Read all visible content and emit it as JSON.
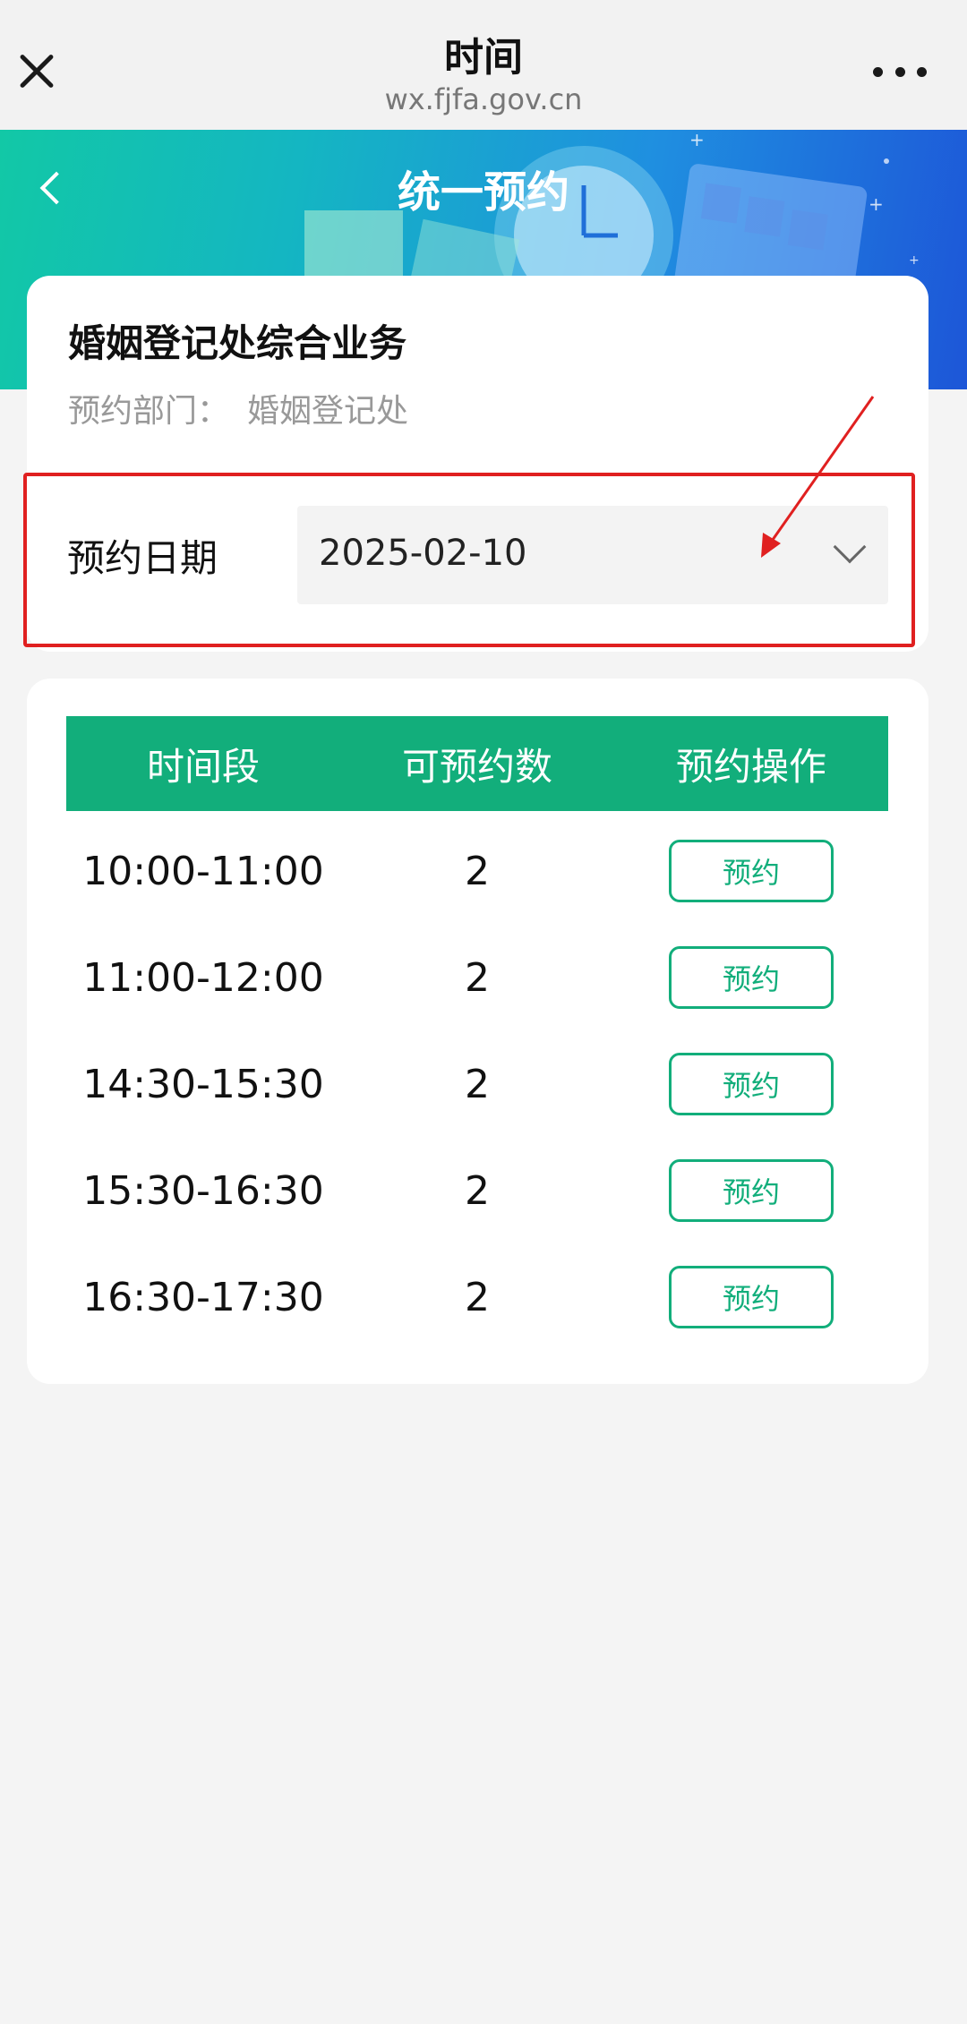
{
  "topbar": {
    "title": "时间",
    "domain": "wx.fjfa.gov.cn",
    "close_icon": "close-icon",
    "more_icon": "more-dots-icon"
  },
  "hero": {
    "title": "统一预约",
    "back_icon": "chevron-left-icon"
  },
  "info": {
    "business_title": "婚姻登记处综合业务",
    "dept_label": "预约部门：",
    "dept_value": "婚姻登记处",
    "date_label": "预约日期",
    "date_value": "2025-02-10",
    "dropdown_icon": "chevron-down-icon"
  },
  "slots": {
    "headers": [
      "时间段",
      "可预约数",
      "预约操作"
    ],
    "rows": [
      {
        "time": "10:00-11:00",
        "count": "2",
        "action": "预约"
      },
      {
        "time": "11:00-12:00",
        "count": "2",
        "action": "预约"
      },
      {
        "time": "14:30-15:30",
        "count": "2",
        "action": "预约"
      },
      {
        "time": "15:30-16:30",
        "count": "2",
        "action": "预约"
      },
      {
        "time": "16:30-17:30",
        "count": "2",
        "action": "预约"
      }
    ]
  },
  "colors": {
    "accent": "#12ae7b",
    "highlight": "#e02020",
    "hero_start": "#12c8a6",
    "hero_end": "#1d56d8"
  }
}
